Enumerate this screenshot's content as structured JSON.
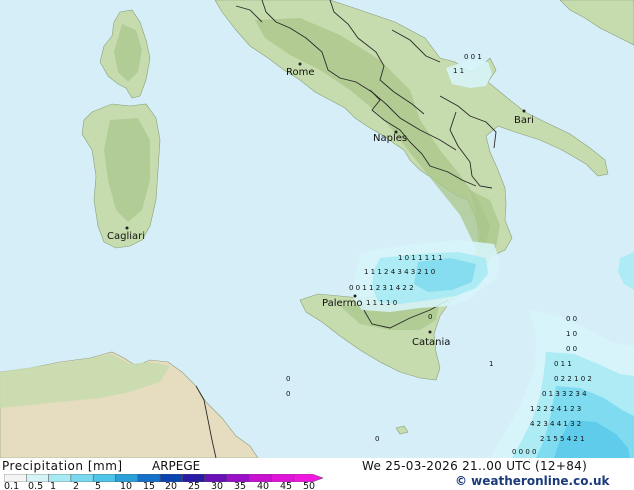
{
  "header": {
    "legend_title": "Precipitation [mm]",
    "model": "ARPEGE",
    "datetime": "We 25-03-2026 21..00 UTC (12+84)",
    "credit": "© weatheronline.co.uk"
  },
  "legend": {
    "ticks": [
      "0.1",
      "0.5",
      "1",
      "2",
      "5",
      "10",
      "15",
      "20",
      "25",
      "30",
      "35",
      "40",
      "45",
      "50"
    ],
    "colors": [
      "#f4f4f4",
      "#d6f4f8",
      "#a8eaf4",
      "#7ad9ee",
      "#4ec4e8",
      "#2a9fd8",
      "#1470c8",
      "#0a44b0",
      "#2a1aa8",
      "#6a10b8",
      "#9a10c8",
      "#c812d0",
      "#e014d8",
      "#f018e0"
    ]
  },
  "colors": {
    "sea": "#d6eef7",
    "land": "#c7dcae",
    "highland": "#a9c58a",
    "desert": "#e6dcc0",
    "rain_light": "#a8eaf4",
    "rain_medium": "#7ad9ee",
    "border": "#2a2a2a"
  },
  "cities": [
    {
      "name": "Rome"
    },
    {
      "name": "Naples"
    },
    {
      "name": "Bari"
    },
    {
      "name": "Cagliari"
    },
    {
      "name": "Palermo"
    },
    {
      "name": "Catania"
    }
  ],
  "precip_rows": [
    {
      "values": "0 0 1"
    },
    {
      "values": "1 0 1 1 1 1 1"
    },
    {
      "values": "1 1 1 2 4 3 4 3 2 1 0"
    },
    {
      "values": "0 0 1 1 2 3 1 4 2 2"
    },
    {
      "values": "1 1 1 1 0"
    },
    {
      "values": "1 1"
    },
    {
      "values": "0"
    },
    {
      "values": "0 0"
    },
    {
      "values": "1 0"
    },
    {
      "values": "0 0"
    },
    {
      "values": "1"
    },
    {
      "values": "0 1 1"
    },
    {
      "values": "0 2 2 1 0 2"
    },
    {
      "values": "0 1 3 3 2 3 4"
    },
    {
      "values": "1 2 2 2 4 1 2 3"
    },
    {
      "values": "4 2 3 4 4 1 3 2"
    },
    {
      "values": "2 1 5 5 4 2 1"
    },
    {
      "values": "0 0 0 0"
    },
    {
      "values": "0"
    },
    {
      "values": "0"
    },
    {
      "values": "0"
    }
  ]
}
